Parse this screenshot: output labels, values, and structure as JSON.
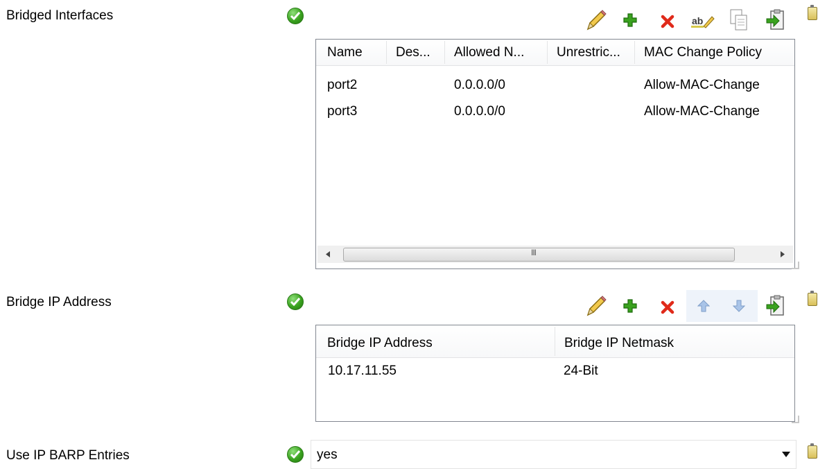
{
  "bridged_interfaces": {
    "label": "Bridged Interfaces",
    "columns": [
      "Name",
      "Des...",
      "Allowed N...",
      "Unrestric...",
      "MAC Change Policy"
    ],
    "rows": [
      [
        "port2",
        "",
        "0.0.0.0/0",
        "",
        "Allow-MAC-Change"
      ],
      [
        "port3",
        "",
        "0.0.0.0/0",
        "",
        "Allow-MAC-Change"
      ]
    ],
    "scroll_thumb_grip": "III"
  },
  "bridge_ip": {
    "label": "Bridge IP Address",
    "columns": [
      "Bridge IP Address",
      "Bridge IP Netmask"
    ],
    "rows": [
      [
        "10.17.11.55",
        "24-Bit"
      ]
    ]
  },
  "barp": {
    "label": "Use IP BARP Entries",
    "value": "yes"
  },
  "toolbar_icons": [
    "pencil-icon",
    "add-icon",
    "delete-icon",
    "rename-icon",
    "copy-icon",
    "import-icon",
    "move-up-icon",
    "move-down-icon",
    "clipboard-icon"
  ]
}
